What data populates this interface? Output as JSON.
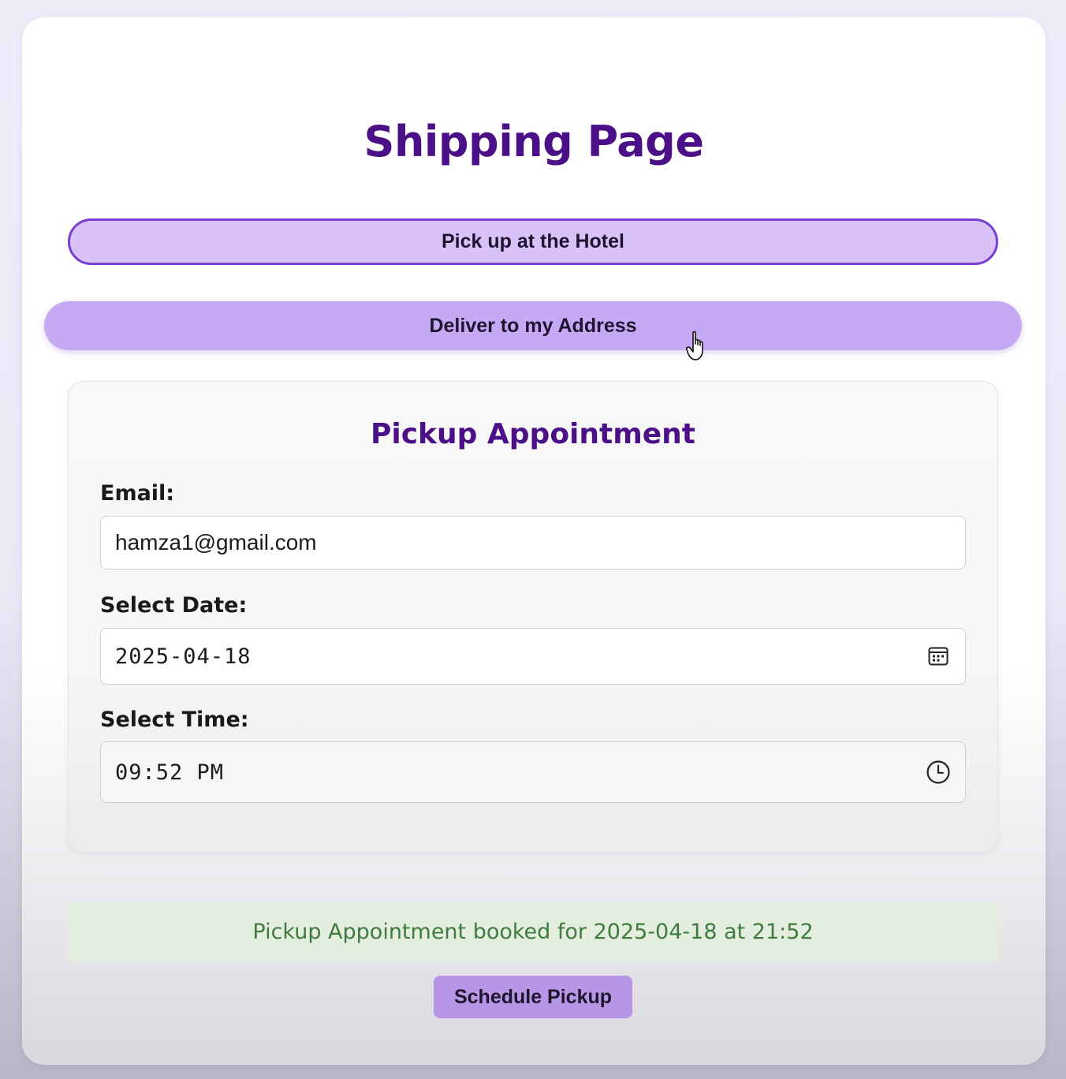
{
  "page": {
    "title": "Shipping Page"
  },
  "shipping_options": {
    "hotel_label": "Pick up at the Hotel",
    "address_label": "Deliver to my Address"
  },
  "appointment": {
    "title": "Pickup Appointment",
    "email_label": "Email:",
    "email_value": "hamza1@gmail.com",
    "date_label": "Select Date:",
    "date_value": "2025-04-18",
    "time_label": "Select Time:",
    "time_value": "09:52 PM"
  },
  "status": {
    "message": "Pickup Appointment booked for 2025-04-18 at 21:52"
  },
  "actions": {
    "schedule_label": "Schedule Pickup"
  },
  "icons": {
    "date": "calendar-icon",
    "time": "clock-icon",
    "cursor": "hand-pointer-icon"
  },
  "colors": {
    "title": "#4b0f87",
    "hotel_button_bg": "#d8c2f7",
    "hotel_button_border": "#7a3fd0",
    "address_button_bg": "#c6a9f5",
    "success_bg": "#e4eedf",
    "success_text": "#3f7a3f",
    "schedule_button_bg": "#b896e6"
  }
}
